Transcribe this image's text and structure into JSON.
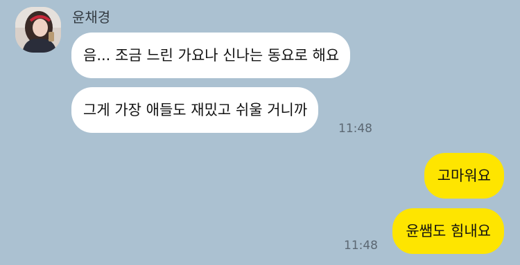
{
  "chat": {
    "sender": {
      "name": "윤채경",
      "avatar_icon": "profile-photo"
    },
    "incoming": [
      {
        "text": "음... 조금 느린 가요나 신나는 동요로 해요"
      },
      {
        "text": "그게 가장 애들도 재밌고 쉬울 거니까",
        "time": "11:48"
      }
    ],
    "outgoing": [
      {
        "text": "고마워요"
      },
      {
        "text": "윤쌤도 힘내요",
        "time": "11:48"
      }
    ]
  },
  "colors": {
    "background": "#abc1d1",
    "incoming_bubble": "#ffffff",
    "outgoing_bubble": "#fee500",
    "timestamp": "#5b6772"
  }
}
